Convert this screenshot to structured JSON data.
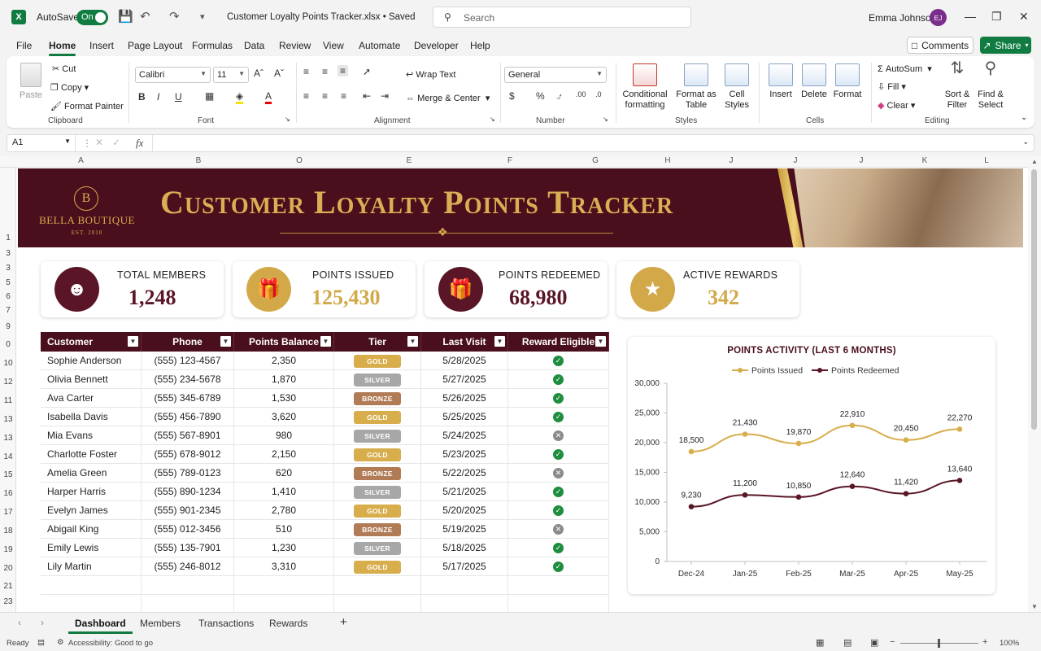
{
  "titlebar": {
    "autosave_label": "AutoSave",
    "autosave_state": "On",
    "doc_title": "Customer Loyalty Points Tracker.xlsx • Saved",
    "search_placeholder": "Search",
    "user_name": "Emma Johnson",
    "user_initials": "EJ"
  },
  "menu": {
    "tabs": [
      "File",
      "Home",
      "Insert",
      "Page Layout",
      "Formulas",
      "Data",
      "Review",
      "View",
      "Automate",
      "Developer",
      "Help"
    ],
    "active": "Home",
    "comments_label": "Comments",
    "share_label": "Share"
  },
  "ribbon": {
    "clipboard": {
      "paste": "Paste",
      "cut": "Cut",
      "copy": "Copy",
      "format_painter": "Format Painter",
      "label": "Clipboard"
    },
    "font": {
      "family": "Calibri",
      "size": "11",
      "label": "Font"
    },
    "alignment": {
      "wrap": "Wrap Text",
      "merge": "Merge & Center",
      "label": "Alignment"
    },
    "number": {
      "format": "General",
      "label": "Number"
    },
    "styles": {
      "conditional": "Conditional formatting",
      "format_table": "Format as Table",
      "cell_styles": "Cell Styles",
      "label": "Styles"
    },
    "cells": {
      "insert": "Insert",
      "delete": "Delete",
      "format": "Format",
      "label": "Cells"
    },
    "editing": {
      "autosum": "AutoSum",
      "fill": "Fill",
      "clear": "Clear",
      "sort": "Sort & Filter",
      "find": "Find & Select",
      "label": "Editing"
    }
  },
  "formula_bar": {
    "name_box": "A1",
    "fx": "fx",
    "formula": ""
  },
  "columns": [
    "A",
    "B",
    "O",
    "E",
    "F",
    "G",
    "H",
    "J",
    "J",
    "J",
    "K",
    "L"
  ],
  "rows": [
    "1",
    "3",
    "3",
    "5",
    "6",
    "7",
    "9",
    "0",
    "10",
    "12",
    "11",
    "13",
    "13",
    "14",
    "15",
    "16",
    "17",
    "18",
    "19",
    "20",
    "21",
    "23"
  ],
  "banner": {
    "logo_letter": "B",
    "logo_name": "BELLA BOUTIQUE",
    "logo_est": "EST. 2010",
    "title": "Customer Loyalty Points Tracker"
  },
  "kpis": [
    {
      "label": "TOTAL MEMBERS",
      "value": "1,248",
      "icon": "members-icon",
      "color": "#5a1626"
    },
    {
      "label": "POINTS ISSUED",
      "value": "125,430",
      "icon": "gift-icon",
      "color": "#d3a849"
    },
    {
      "label": "POINTS REDEEMED",
      "value": "68,980",
      "icon": "gift-icon",
      "color": "#5a1626"
    },
    {
      "label": "ACTIVE REWARDS",
      "value": "342",
      "icon": "star-icon",
      "color": "#d3a849"
    }
  ],
  "table": {
    "headers": [
      "Customer",
      "Phone",
      "Points Balance",
      "Tier",
      "Last Visit",
      "Reward Eligible"
    ],
    "rows": [
      {
        "customer": "Sophie Anderson",
        "phone": "(555) 123-4567",
        "points": "2,350",
        "tier": "GOLD",
        "last_visit": "5/28/2025",
        "eligible": true
      },
      {
        "customer": "Olivia Bennett",
        "phone": "(555) 234-5678",
        "points": "1,870",
        "tier": "SILVER",
        "last_visit": "5/27/2025",
        "eligible": true
      },
      {
        "customer": "Ava Carter",
        "phone": "(555) 345-6789",
        "points": "1,530",
        "tier": "BRONZE",
        "last_visit": "5/26/2025",
        "eligible": true
      },
      {
        "customer": "Isabella Davis",
        "phone": "(555) 456-7890",
        "points": "3,620",
        "tier": "GOLD",
        "last_visit": "5/25/2025",
        "eligible": true
      },
      {
        "customer": "Mia Evans",
        "phone": "(555) 567-8901",
        "points": "980",
        "tier": "SILVER",
        "last_visit": "5/24/2025",
        "eligible": false
      },
      {
        "customer": "Charlotte Foster",
        "phone": "(555) 678-9012",
        "points": "2,150",
        "tier": "GOLD",
        "last_visit": "5/23/2025",
        "eligible": true
      },
      {
        "customer": "Amelia Green",
        "phone": "(555) 789-0123",
        "points": "620",
        "tier": "BRONZE",
        "last_visit": "5/22/2025",
        "eligible": false
      },
      {
        "customer": "Harper Harris",
        "phone": "(555) 890-1234",
        "points": "1,410",
        "tier": "SILVER",
        "last_visit": "5/21/2025",
        "eligible": true
      },
      {
        "customer": "Evelyn James",
        "phone": "(555) 901-2345",
        "points": "2,780",
        "tier": "GOLD",
        "last_visit": "5/20/2025",
        "eligible": true
      },
      {
        "customer": "Abigail King",
        "phone": "(555) 012-3456",
        "points": "510",
        "tier": "BRONZE",
        "last_visit": "5/19/2025",
        "eligible": false
      },
      {
        "customer": "Emily Lewis",
        "phone": "(555) 135-7901",
        "points": "1,230",
        "tier": "SILVER",
        "last_visit": "5/18/2025",
        "eligible": true
      },
      {
        "customer": "Lily Martin",
        "phone": "(555) 246-8012",
        "points": "3,310",
        "tier": "GOLD",
        "last_visit": "5/17/2025",
        "eligible": true
      }
    ],
    "tier_colors": {
      "GOLD": "#d8ad4c",
      "SILVER": "#a7a7a7",
      "BRONZE": "#b07b55"
    }
  },
  "chart_data": {
    "type": "line",
    "title": "POINTS ACTIVITY (LAST 6 MONTHS)",
    "categories": [
      "Dec-24",
      "Jan-25",
      "Feb-25",
      "Mar-25",
      "Apr-25",
      "May-25"
    ],
    "series": [
      {
        "name": "Points Issued",
        "values": [
          18500,
          21430,
          19870,
          22910,
          20450,
          22270
        ],
        "color": "#d8ad4c"
      },
      {
        "name": "Points Redeemed",
        "values": [
          9230,
          11200,
          10850,
          12640,
          11420,
          13640
        ],
        "color": "#5a1626"
      }
    ],
    "yticks": [
      "30,000",
      "25,000",
      "20,000",
      "15,000",
      "10,000",
      "5,000",
      "0"
    ],
    "ylim": [
      0,
      30000
    ],
    "legend": "top"
  },
  "sheets": {
    "tabs": [
      "Dashboard",
      "Members",
      "Transactions",
      "Rewards"
    ],
    "active": "Dashboard",
    "add": "+"
  },
  "status": {
    "ready": "Ready",
    "accessibility": "Accessibility: Good to go",
    "zoom": "100%"
  }
}
